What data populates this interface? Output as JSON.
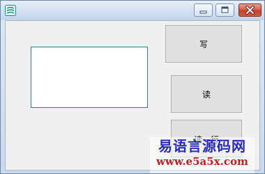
{
  "window": {
    "title": "",
    "icon": "app-icon"
  },
  "caption_buttons": {
    "minimize_icon": "minimize-icon",
    "maximize_icon": "maximize-icon",
    "close_icon": "close-icon"
  },
  "main": {
    "text_box_value": "",
    "buttons": {
      "write": "写",
      "read": "读",
      "read_line": "读一行"
    }
  },
  "watermark": {
    "line1": "易语言源码网",
    "line2": "www.e5a5x.com"
  },
  "colors": {
    "watermark_primary": "#2a2ab8",
    "watermark_secondary": "#c21d1d",
    "close_button": "#c0412b",
    "text_box_border": "#2f7f8a"
  }
}
